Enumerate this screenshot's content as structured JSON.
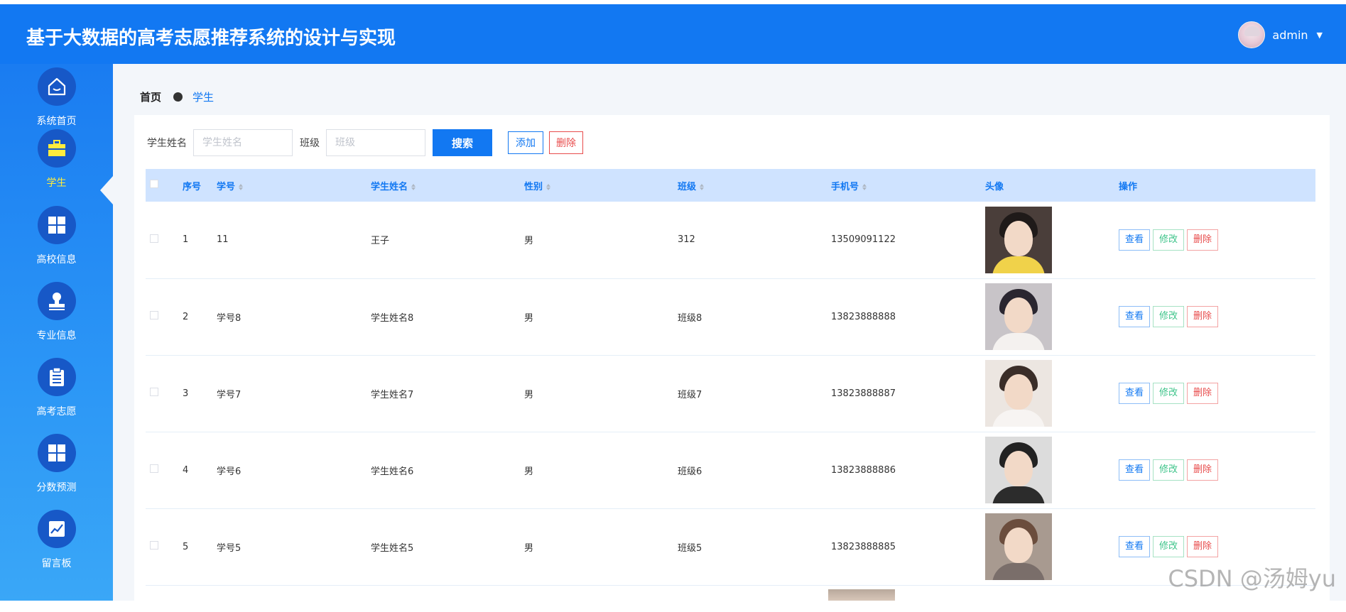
{
  "header": {
    "title": "基于大数据的高考志愿推荐系统的设计与实现",
    "username": "admin",
    "bg_color": "#1278f2"
  },
  "sidebar": {
    "items": [
      {
        "label": "系统首页",
        "icon": "home-icon"
      },
      {
        "label": "学生",
        "icon": "briefcase-icon",
        "active": true
      },
      {
        "label": "高校信息",
        "icon": "grid-icon"
      },
      {
        "label": "专业信息",
        "icon": "stamp-icon"
      },
      {
        "label": "高考志愿",
        "icon": "clipboard-icon"
      },
      {
        "label": "分数预测",
        "icon": "grid-icon"
      },
      {
        "label": "留言板",
        "icon": "chart-icon"
      }
    ]
  },
  "breadcrumb": {
    "home": "首页",
    "current": "学生"
  },
  "search": {
    "name_label": "学生姓名",
    "name_placeholder": "学生姓名",
    "class_label": "班级",
    "class_placeholder": "班级",
    "search_button": "搜索",
    "add_button": "添加",
    "delete_button": "删除"
  },
  "table": {
    "columns": {
      "index": "序号",
      "student_no": "学号",
      "student_name": "学生姓名",
      "gender": "性别",
      "class": "班级",
      "phone": "手机号",
      "avatar": "头像",
      "actions": "操作"
    },
    "rows": [
      {
        "index": "1",
        "student_no": "11",
        "student_name": "王子",
        "gender": "男",
        "class": "312",
        "phone": "13509091122"
      },
      {
        "index": "2",
        "student_no": "学号8",
        "student_name": "学生姓名8",
        "gender": "男",
        "class": "班级8",
        "phone": "13823888888"
      },
      {
        "index": "3",
        "student_no": "学号7",
        "student_name": "学生姓名7",
        "gender": "男",
        "class": "班级7",
        "phone": "13823888887"
      },
      {
        "index": "4",
        "student_no": "学号6",
        "student_name": "学生姓名6",
        "gender": "男",
        "class": "班级6",
        "phone": "13823888886"
      },
      {
        "index": "5",
        "student_no": "学号5",
        "student_name": "学生姓名5",
        "gender": "男",
        "class": "班级5",
        "phone": "13823888885"
      }
    ],
    "actions": {
      "view": "查看",
      "edit": "修改",
      "delete": "删除"
    }
  },
  "watermark": "CSDN @汤姆yu"
}
